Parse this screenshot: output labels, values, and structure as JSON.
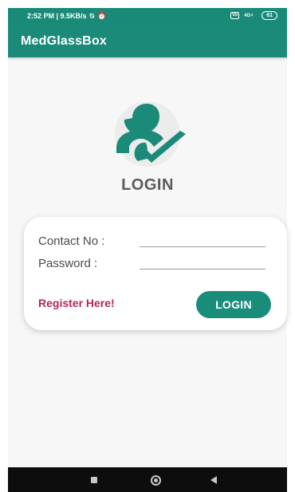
{
  "status_bar": {
    "time_speed": "2:52 PM | 9.5KB/s",
    "mute_icon": "⍉",
    "alarm_icon": "⏰",
    "volte": "Vo",
    "signal": "4G+",
    "battery": "61"
  },
  "app_bar": {
    "title": "MedGlassBox"
  },
  "login": {
    "heading": "LOGIN",
    "contact_label": "Contact No :",
    "password_label": "Password :",
    "register_link": "Register Here!",
    "login_button": "LOGIN"
  },
  "colors": {
    "primary": "#1c8a79",
    "accent": "#b0265f"
  }
}
